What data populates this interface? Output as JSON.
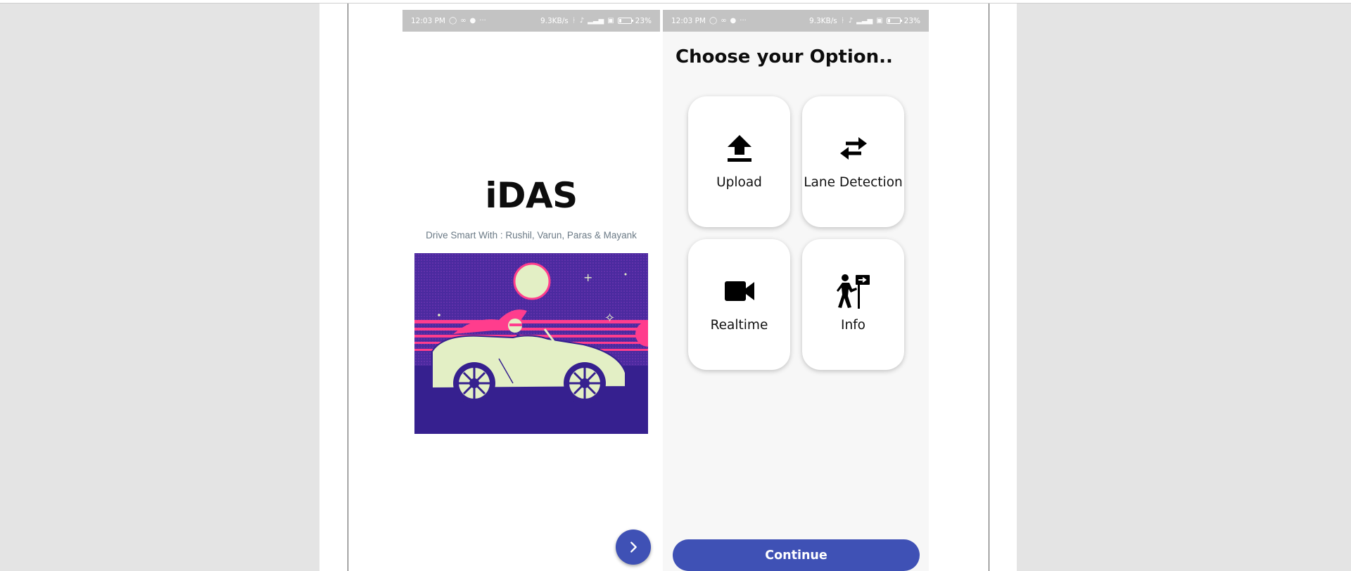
{
  "status_bar": {
    "time": "12:03 PM",
    "speed": "9.3KB/s",
    "battery": "23",
    "battery_level_pct": 23,
    "icons": [
      "whatsapp-icon",
      "infinity-icon",
      "phone-icon",
      "more-dots-icon",
      "bluetooth-icon",
      "mute-icon",
      "signal-icon",
      "volte-icon",
      "4g-icon",
      "battery-icon"
    ]
  },
  "splash": {
    "title": "iDAS",
    "subtitle": "Drive Smart With : Rushil, Varun, Paras & Mayank",
    "illustration": "woman-driving-convertible-illustration",
    "next_icon": "chevron-right-icon"
  },
  "options_screen": {
    "title": "Choose your Option..",
    "options": [
      {
        "label": "Upload",
        "icon": "upload-icon"
      },
      {
        "label": "Lane Detection",
        "icon": "swap-horizontal-icon"
      },
      {
        "label": "Realtime",
        "icon": "videocam-icon"
      },
      {
        "label": "Info",
        "icon": "hiker-sign-icon"
      }
    ],
    "continue_label": "Continue"
  },
  "colors": {
    "accent": "#3f51b5",
    "background": "#e4e4e4",
    "status_bar": "#c3c3c3",
    "subtitle_text": "#6b7a86",
    "illustration_purple": "#4b2a9f",
    "illustration_pink": "#ff3d8d",
    "illustration_cream": "#e3efc5"
  }
}
